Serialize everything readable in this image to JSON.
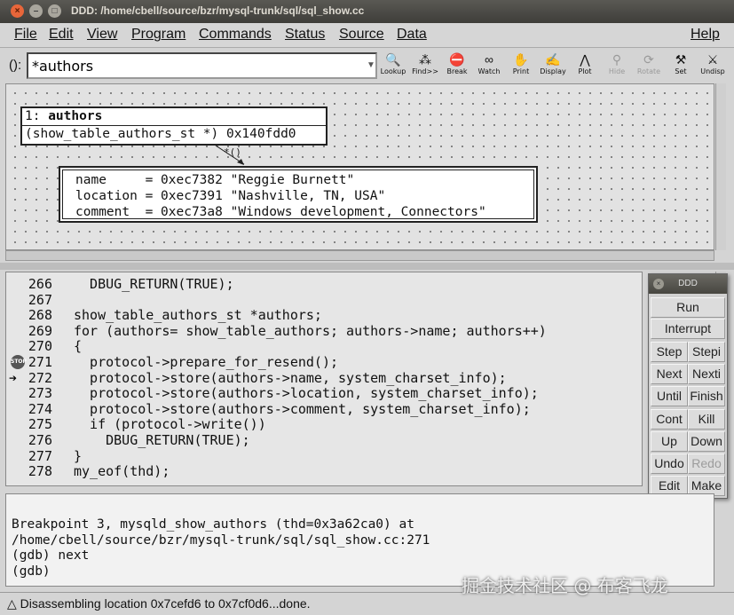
{
  "window": {
    "title": "DDD: /home/cbell/source/bzr/mysql-trunk/sql/sql_show.cc"
  },
  "menu": [
    "File",
    "Edit",
    "View",
    "Program",
    "Commands",
    "Status",
    "Source",
    "Data",
    "Help"
  ],
  "toolbar": {
    "arg_label": "():",
    "arg_value": "*authors",
    "buttons": [
      {
        "label": "Lookup",
        "icon": "lookup-icon",
        "glyph": "🔍",
        "enabled": true
      },
      {
        "label": "Find>>",
        "icon": "find-icon",
        "glyph": "⁂",
        "enabled": true
      },
      {
        "label": "Break",
        "icon": "stop-sign-icon",
        "glyph": "⛔",
        "enabled": true
      },
      {
        "label": "Watch",
        "icon": "glasses-icon",
        "glyph": "∞",
        "enabled": true
      },
      {
        "label": "Print",
        "icon": "print-icon",
        "glyph": "✋",
        "enabled": true
      },
      {
        "label": "Display",
        "icon": "display-icon",
        "glyph": "✍",
        "enabled": true
      },
      {
        "label": "Plot",
        "icon": "plot-icon",
        "glyph": "⋀",
        "enabled": true
      },
      {
        "label": "Hide",
        "icon": "hide-icon",
        "glyph": "⚲",
        "enabled": false
      },
      {
        "label": "Rotate",
        "icon": "rotate-icon",
        "glyph": "⟳",
        "enabled": false
      },
      {
        "label": "Set",
        "icon": "set-icon",
        "glyph": "⚒",
        "enabled": true
      },
      {
        "label": "Undisp",
        "icon": "undisplay-icon",
        "glyph": "⚔",
        "enabled": true
      }
    ]
  },
  "data_window": {
    "display1": {
      "index": "1:",
      "name": "authors",
      "value": "(show_table_authors_st *) 0x140fdd0"
    },
    "pointer_label": "*()",
    "display2": [
      "name     = 0xec7382 \"Reggie Burnett\"",
      "location = 0xec7391 \"Nashville, TN, USA\"",
      "comment  = 0xec73a8 \"Windows development, Connectors\""
    ]
  },
  "source": {
    "lines": [
      {
        "num": "266",
        "code": "  DBUG_RETURN(TRUE);",
        "marker": ""
      },
      {
        "num": "267",
        "code": "",
        "marker": ""
      },
      {
        "num": "268",
        "code": "show_table_authors_st *authors;",
        "marker": ""
      },
      {
        "num": "269",
        "code": "for (authors= show_table_authors; authors->name; authors++)",
        "marker": ""
      },
      {
        "num": "270",
        "code": "{",
        "marker": ""
      },
      {
        "num": "271",
        "code": "  protocol->prepare_for_resend();",
        "marker": "breakpoint"
      },
      {
        "num": "272",
        "code": "  protocol->store(authors->name, system_charset_info);",
        "marker": "exec"
      },
      {
        "num": "273",
        "code": "  protocol->store(authors->location, system_charset_info);",
        "marker": ""
      },
      {
        "num": "274",
        "code": "  protocol->store(authors->comment, system_charset_info);",
        "marker": ""
      },
      {
        "num": "275",
        "code": "  if (protocol->write())",
        "marker": ""
      },
      {
        "num": "276",
        "code": "    DBUG_RETURN(TRUE);",
        "marker": ""
      },
      {
        "num": "277",
        "code": "}",
        "marker": ""
      },
      {
        "num": "278",
        "code": "my_eof(thd);",
        "marker": ""
      }
    ],
    "stop_label": "STOP"
  },
  "command_tool": {
    "title": "DDD",
    "run": "Run",
    "interrupt": "Interrupt",
    "pairs": [
      {
        "left": "Step",
        "right": "Stepi",
        "left_enabled": true,
        "right_enabled": true
      },
      {
        "left": "Next",
        "right": "Nexti",
        "left_enabled": true,
        "right_enabled": true
      },
      {
        "left": "Until",
        "right": "Finish",
        "left_enabled": true,
        "right_enabled": true
      },
      {
        "left": "Cont",
        "right": "Kill",
        "left_enabled": true,
        "right_enabled": true
      },
      {
        "left": "Up",
        "right": "Down",
        "left_enabled": true,
        "right_enabled": true
      },
      {
        "left": "Undo",
        "right": "Redo",
        "left_enabled": true,
        "right_enabled": false
      },
      {
        "left": "Edit",
        "right": "Make",
        "left_enabled": true,
        "right_enabled": true
      }
    ]
  },
  "console": {
    "lines": [
      "Breakpoint 3, mysqld_show_authors (thd=0x3a62ca0) at",
      "/home/cbell/source/bzr/mysql-trunk/sql/sql_show.cc:271",
      "(gdb) next",
      "(gdb) "
    ]
  },
  "status": "Disassembling location 0x7cefd6 to 0x7cf0d6...done.",
  "watermark": "掘金技术社区 @ 布客飞龙"
}
